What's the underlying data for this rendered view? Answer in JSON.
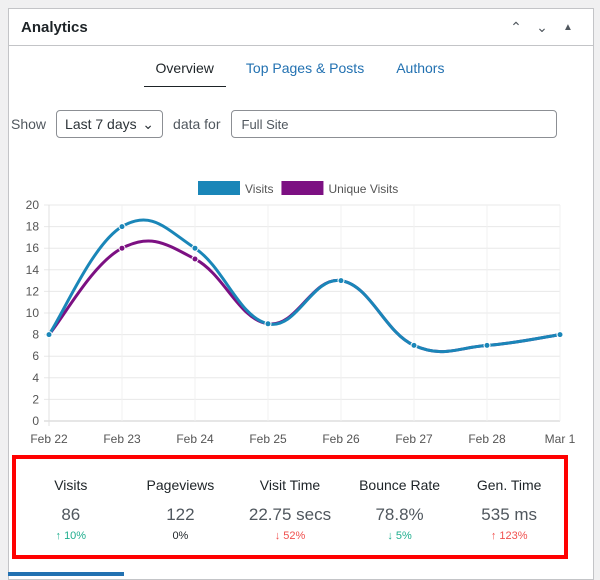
{
  "header": {
    "title": "Analytics",
    "controls": [
      "chevron-up",
      "chevron-down",
      "triangle-up"
    ]
  },
  "tabs": [
    {
      "label": "Overview",
      "active": true
    },
    {
      "label": "Top Pages & Posts"
    },
    {
      "label": "Authors"
    }
  ],
  "filter": {
    "show_label": "Show",
    "range": "Last 7 days",
    "data_for_label": "data for",
    "site": "Full Site"
  },
  "chart_data": {
    "type": "line",
    "categories": [
      "Feb 22",
      "Feb 23",
      "Feb 24",
      "Feb 25",
      "Feb 26",
      "Feb 27",
      "Feb 28",
      "Mar 1"
    ],
    "series": [
      {
        "name": "Visits",
        "color": "#1a86b8",
        "values": [
          8,
          18,
          16,
          9,
          13,
          7,
          7,
          8
        ]
      },
      {
        "name": "Unique Visits",
        "color": "#7c1082",
        "values": [
          8,
          16,
          15,
          9,
          13,
          7,
          7,
          8
        ]
      }
    ],
    "ylim": [
      0,
      20
    ],
    "yticks": [
      0,
      2,
      4,
      6,
      8,
      10,
      12,
      14,
      16,
      18,
      20
    ],
    "grid": true,
    "legend": "top"
  },
  "stats": [
    {
      "label": "Visits",
      "value": "86",
      "change": "10%",
      "dir": "up",
      "color": "#1fae8e"
    },
    {
      "label": "Pageviews",
      "value": "122",
      "change": "0%",
      "dir": "none",
      "color": "#1d2327"
    },
    {
      "label": "Visit Time",
      "value": "22.75 secs",
      "change": "52%",
      "dir": "down",
      "color": "#f0504e"
    },
    {
      "label": "Bounce Rate",
      "value": "78.8%",
      "change": "5%",
      "dir": "down",
      "color": "#1fae8e"
    },
    {
      "label": "Gen. Time",
      "value": "535 ms",
      "change": "123%",
      "dir": "up",
      "color": "#f0504e"
    }
  ]
}
